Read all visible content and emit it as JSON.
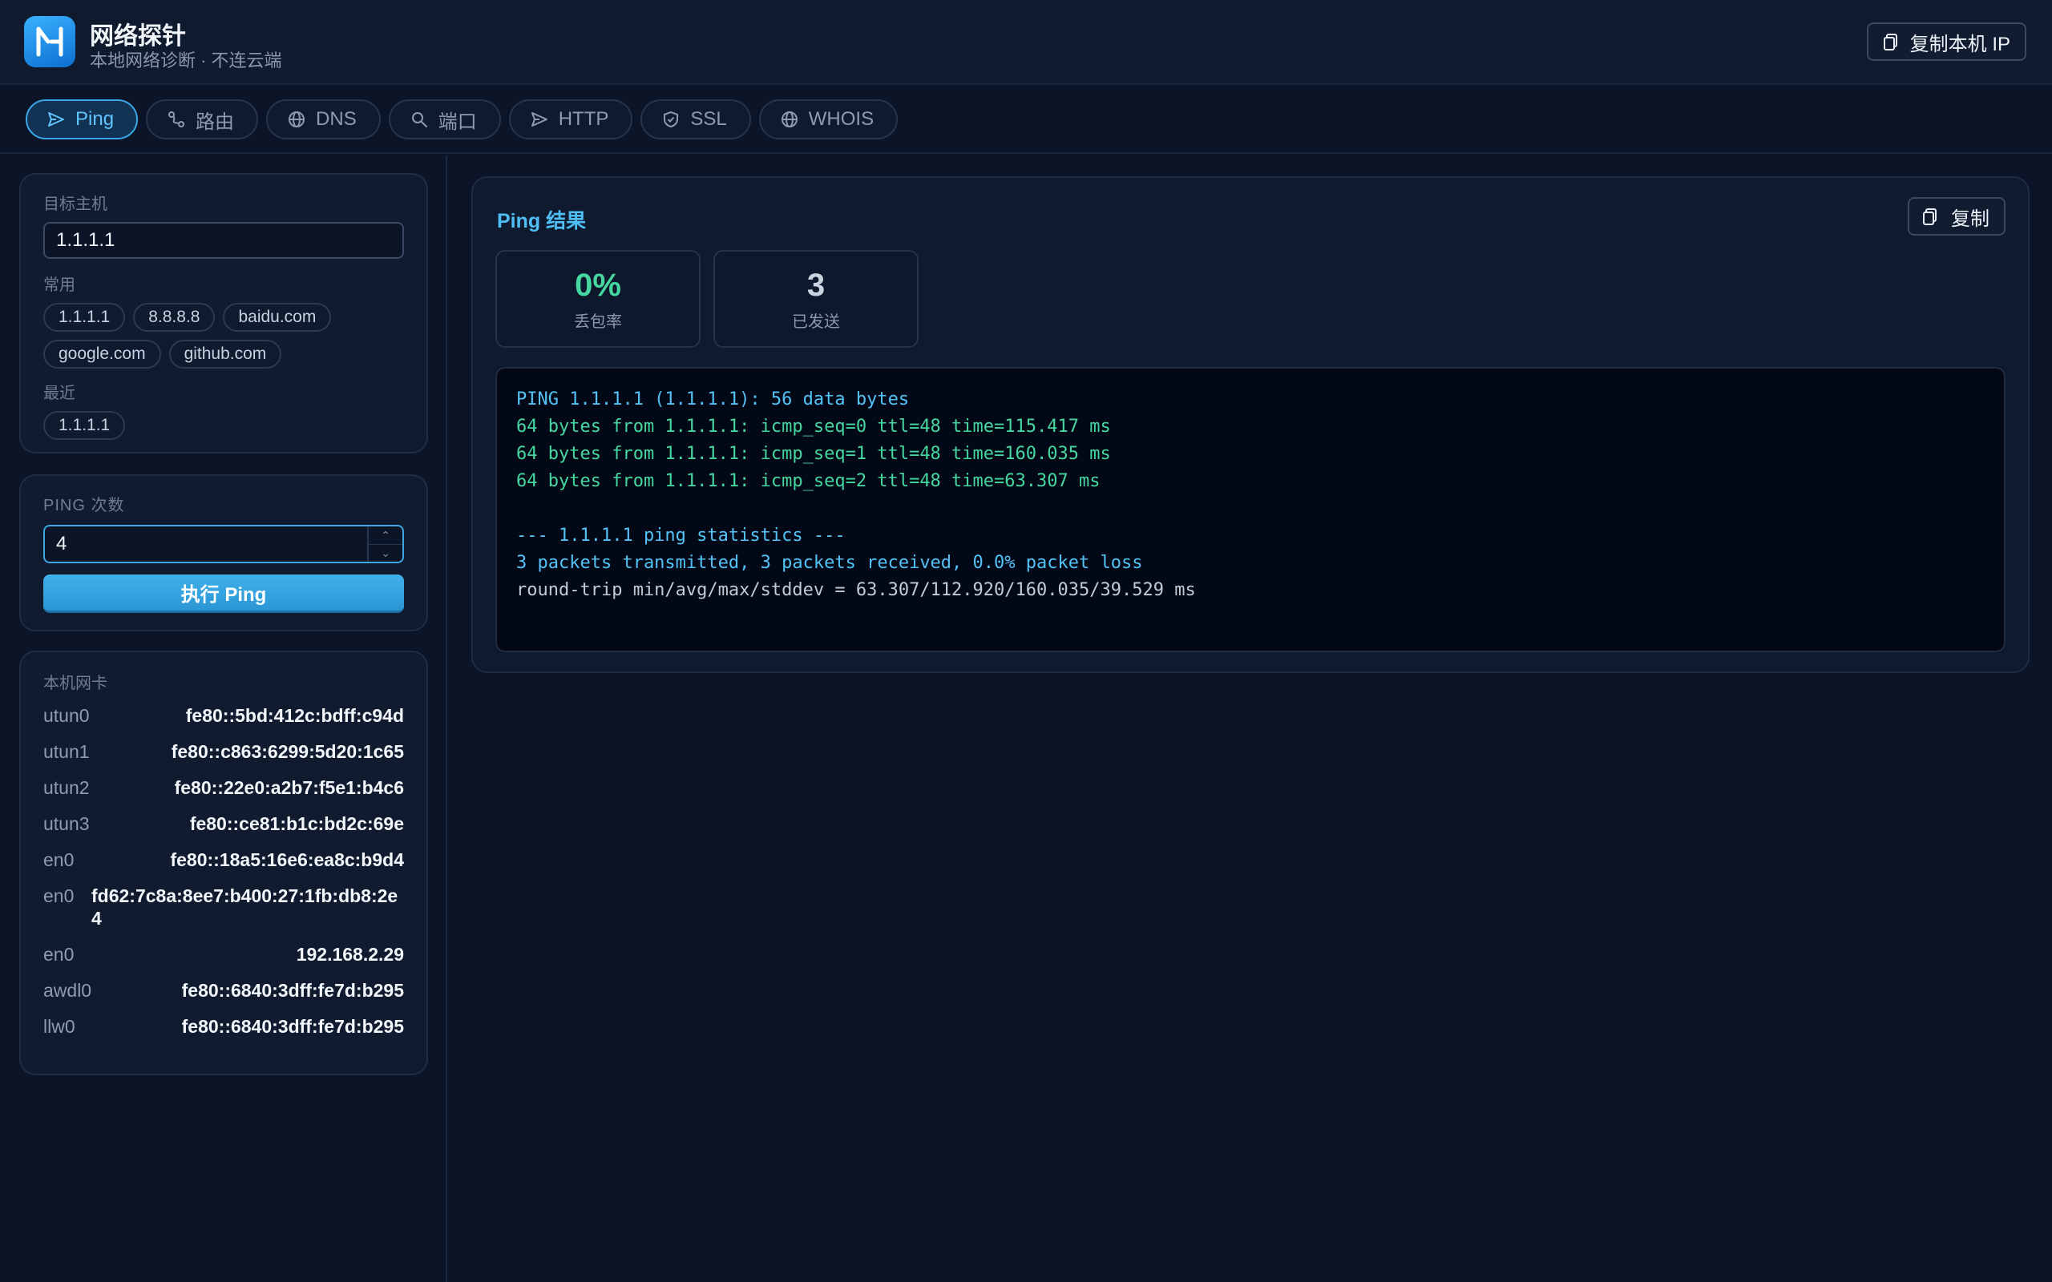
{
  "app": {
    "title": "网络探针",
    "subtitle": "本地网络诊断 · 不连云端",
    "copy_ip_label": "复制本机 IP"
  },
  "tabs": [
    {
      "label": "Ping",
      "icon": "send-icon",
      "active": true
    },
    {
      "label": "路由",
      "icon": "route-icon"
    },
    {
      "label": "DNS",
      "icon": "globe-icon"
    },
    {
      "label": "端口",
      "icon": "search-icon"
    },
    {
      "label": "HTTP",
      "icon": "send-icon"
    },
    {
      "label": "SSL",
      "icon": "shield-icon"
    },
    {
      "label": "WHOIS",
      "icon": "globe-icon"
    }
  ],
  "target": {
    "label": "目标主机",
    "value": "1.1.1.1",
    "common_label": "常用",
    "common": [
      "1.1.1.1",
      "8.8.8.8",
      "baidu.com",
      "google.com",
      "github.com"
    ],
    "recent_label": "最近",
    "recent": [
      "1.1.1.1"
    ]
  },
  "ping_count": {
    "label": "PING 次数",
    "value": "4",
    "run_label": "执行 Ping"
  },
  "nics": {
    "label": "本机网卡",
    "items": [
      {
        "name": "utun0",
        "addr": "fe80::5bd:412c:bdff:c94d"
      },
      {
        "name": "utun1",
        "addr": "fe80::c863:6299:5d20:1c65"
      },
      {
        "name": "utun2",
        "addr": "fe80::22e0:a2b7:f5e1:b4c6"
      },
      {
        "name": "utun3",
        "addr": "fe80::ce81:b1c:bd2c:69e"
      },
      {
        "name": "en0",
        "addr": "fe80::18a5:16e6:ea8c:b9d4"
      },
      {
        "name": "en0",
        "addr": "fd62:7c8a:8ee7:b400:27:1fb:db8:2e4"
      },
      {
        "name": "en0",
        "addr": "192.168.2.29"
      },
      {
        "name": "awdl0",
        "addr": "fe80::6840:3dff:fe7d:b295"
      },
      {
        "name": "llw0",
        "addr": "fe80::6840:3dff:fe7d:b295"
      }
    ]
  },
  "result": {
    "title": "Ping 结果",
    "copy_label": "复制",
    "loss_value": "0%",
    "loss_label": "丢包率",
    "sent_value": "3",
    "sent_label": "已发送",
    "output": [
      "PING 1.1.1.1 (1.1.1.1): 56 data bytes",
      "64 bytes from 1.1.1.1: icmp_seq=0 ttl=48 time=115.417 ms",
      "64 bytes from 1.1.1.1: icmp_seq=1 ttl=48 time=160.035 ms",
      "64 bytes from 1.1.1.1: icmp_seq=2 ttl=48 time=63.307 ms",
      "",
      "--- 1.1.1.1 ping statistics ---",
      "3 packets transmitted, 3 packets received, 0.0% packet loss",
      "round-trip min/avg/max/stddev = 63.307/112.920/160.035/39.529 ms"
    ]
  },
  "colors": {
    "accent": "#3aa8e8",
    "success": "#46d7a0",
    "background": "#0c1427"
  }
}
